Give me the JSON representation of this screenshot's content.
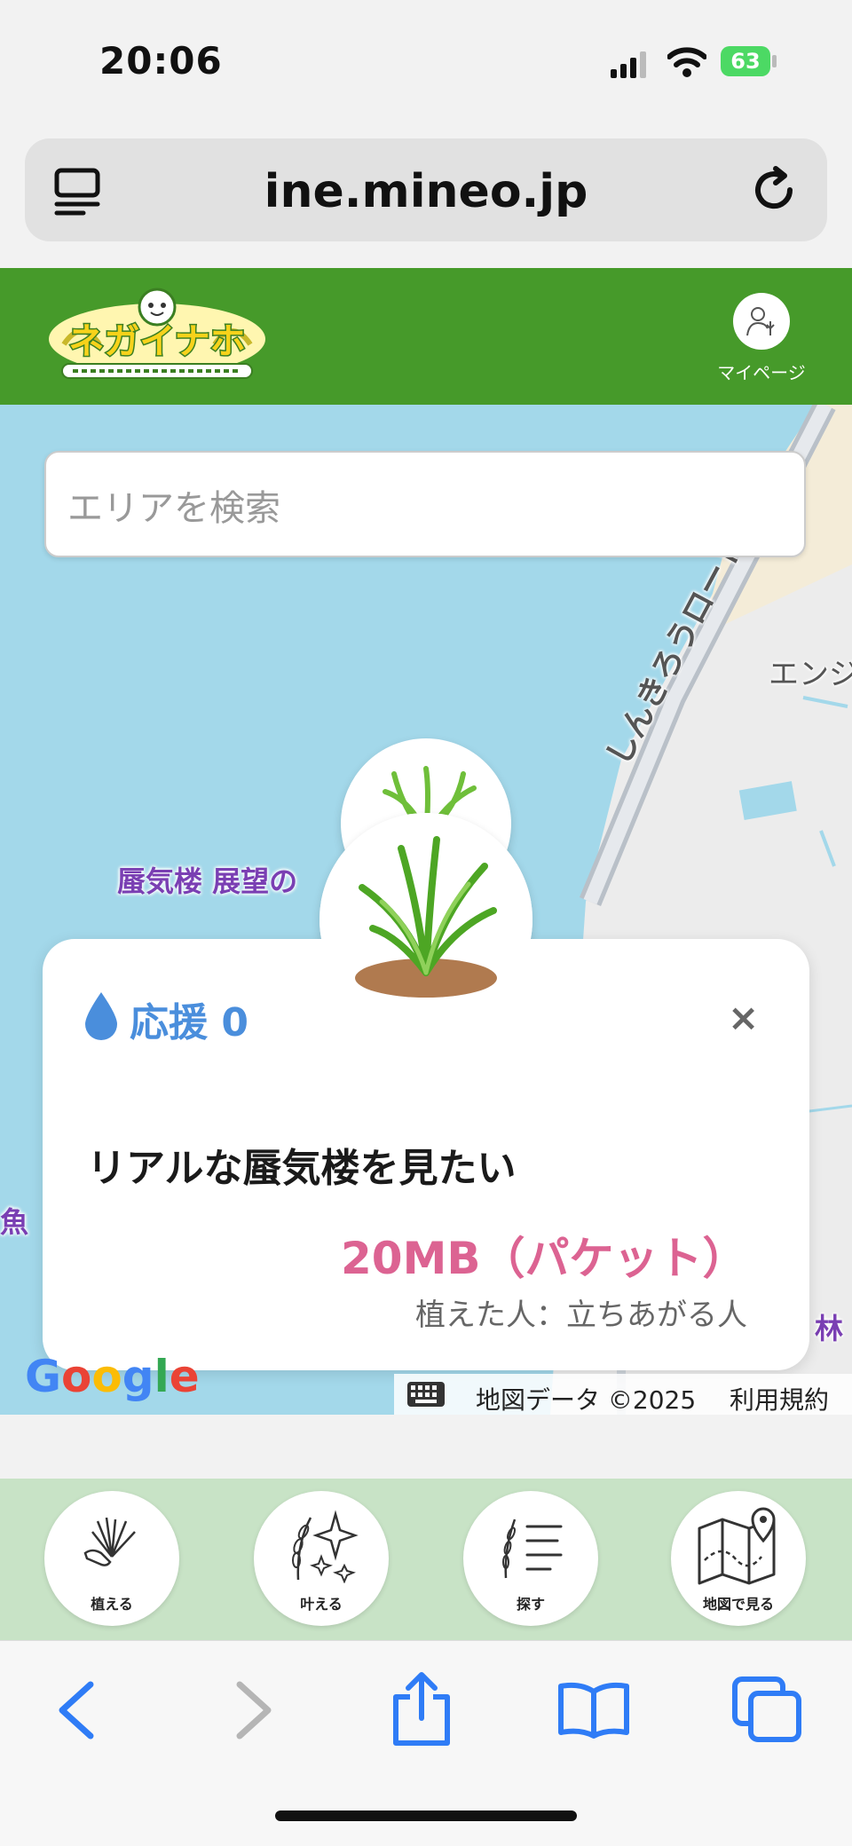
{
  "status_bar": {
    "time": "20:06",
    "battery": "63"
  },
  "browser": {
    "url": "ine.mineo.jp"
  },
  "site": {
    "mypage_label": "マイページ"
  },
  "map": {
    "search_placeholder": "エリアを検索",
    "labels": {
      "road": "しんきろうロード",
      "eng": "エンジ",
      "observatory": "蜃気楼 展望の",
      "fish": "魚",
      "forest": "林"
    },
    "google_logo": "Google",
    "map_data": "地図データ ©2025",
    "terms": "利用規約"
  },
  "card": {
    "support": "応援 0",
    "close": "×",
    "title": "リアルな蜃気楼を見たい",
    "reward": "20MB（パケット）",
    "planter": "植えた人：立ちあがる人"
  },
  "actions": [
    {
      "label": "植える",
      "icon": "plant-hand-icon"
    },
    {
      "label": "叶える",
      "icon": "sparkle-grain-icon"
    },
    {
      "label": "探す",
      "icon": "grain-list-icon"
    },
    {
      "label": "地図で見る",
      "icon": "map-pin-icon"
    }
  ],
  "colors": {
    "header_green": "#469a2a",
    "support_blue": "#4a8edc",
    "reward_pink": "#dc6392",
    "map_water": "#a3d8ea"
  }
}
